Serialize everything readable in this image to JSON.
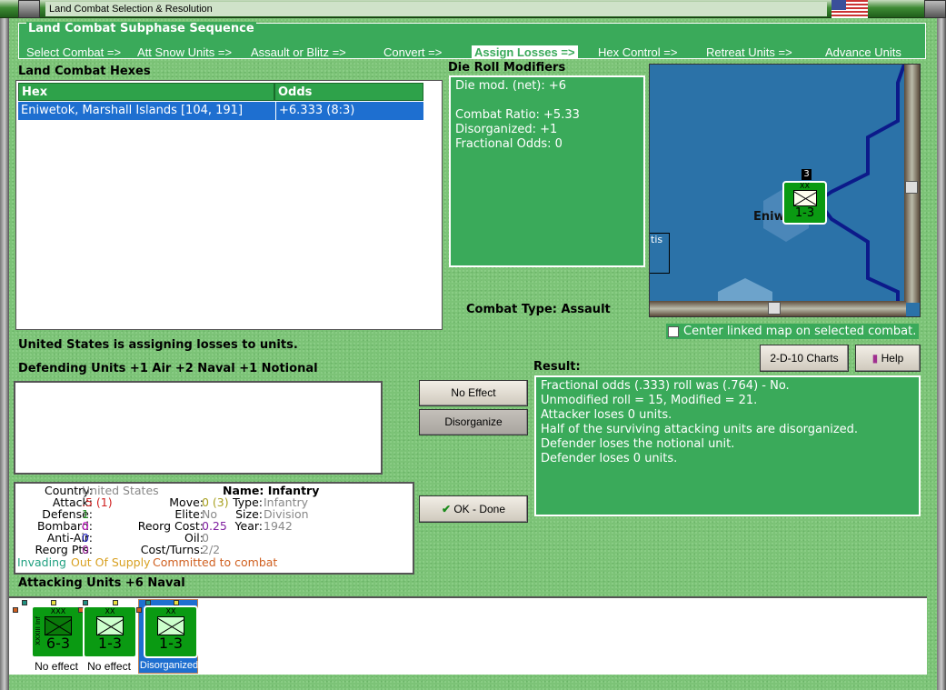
{
  "window": {
    "title": "Land Combat Selection & Resolution"
  },
  "subphase": {
    "legend": "Land Combat Subphase Sequence",
    "steps": [
      "Select Combat =>",
      "Att Snow Units =>",
      "Assault or Blitz =>",
      "Convert =>",
      "Assign Losses =>",
      "Hex Control =>",
      "Retreat Units =>",
      "Advance Units"
    ],
    "active_index": 4
  },
  "hexes": {
    "label": "Land Combat Hexes",
    "columns": [
      "Hex",
      "Odds"
    ],
    "rows": [
      {
        "hex": "Eniwetok, Marshall Islands [104, 191]",
        "odds": "+6.333 (8:3)"
      }
    ]
  },
  "modifiers": {
    "label": "Die Roll Modifiers",
    "lines": [
      "Die mod. (net): +6",
      "",
      "Combat Ratio: +5.33",
      "Disorganized: +1",
      "Fractional Odds: 0"
    ]
  },
  "combat_type": {
    "label": "Combat Type:",
    "value": "Assault"
  },
  "map": {
    "place": "Eniw",
    "unit_strength": "1-3",
    "stack_count": "3",
    "unit_size": "XX",
    "partial_label": "tis"
  },
  "center_checkbox": {
    "label": "Center linked map on selected combat.",
    "checked": false
  },
  "status": "United States is assigning losses to units.",
  "buttons": {
    "charts": "2-D-10 Charts",
    "help": "Help",
    "no_effect": "No Effect",
    "disorganize": "Disorganize",
    "ok": "OK - Done"
  },
  "defending": {
    "label": "Defending Units +1 Air +2 Naval +1 Notional"
  },
  "result": {
    "label": "Result:",
    "lines": [
      "Fractional odds (.333) roll was (.764)  - No.",
      "Unmodified roll = 15, Modified = 21.",
      "Attacker loses 0 units.",
      "Half of the surviving attacking units are disorganized.",
      "Defender loses the notional unit.",
      "Defender loses 0 units."
    ]
  },
  "info": {
    "country_k": "Country:",
    "country": "United States",
    "attack_k": "Attack:",
    "attack": ".5 (1)",
    "defense_k": "Defense:",
    "defense": "1",
    "bombard_k": "Bombard:",
    "bombard": "0",
    "aa_k": "Anti-Air:",
    "aa": "0",
    "reorg_k": "Reorg Pts:",
    "reorg": "0",
    "move_k": "Move:",
    "move": "0 (3)",
    "elite_k": "Elite:",
    "elite": "No",
    "rcost_k": "Reorg Cost:",
    "rcost": "0.25",
    "oil_k": "Oil:",
    "oil": "0",
    "cost_k": "Cost/Turns:",
    "cost": "2/2",
    "name": "Name: Infantry",
    "type_k": "Type:",
    "type": "Infantry",
    "size_k": "Size:",
    "size": "Division",
    "year_k": "Year:",
    "year": "1942",
    "flag1": "Invading",
    "flag2": "Out Of Supply",
    "flag3": "Committed to combat"
  },
  "attacking": {
    "label": "Attacking Units +6 Naval",
    "units": [
      {
        "size": "XXX",
        "side": "XXXIII Inf",
        "strength": "6-3",
        "status": "No effect",
        "selected": false
      },
      {
        "size": "XX",
        "strength": "1-3",
        "status": "No effect",
        "selected": false
      },
      {
        "size": "XX",
        "strength": "1-3",
        "status": "Disorganized",
        "selected": true
      }
    ]
  },
  "colors": {
    "panel_green": "#3aaa5a",
    "selection_blue": "#1e6fd0",
    "sea": "#2b72a8"
  }
}
